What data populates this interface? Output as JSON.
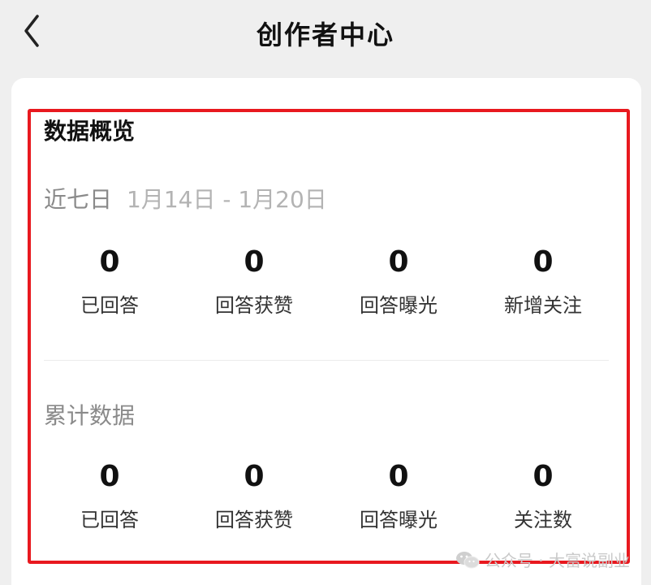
{
  "header": {
    "title": "创作者中心"
  },
  "overview": {
    "title": "数据概览",
    "recent": {
      "label": "近七日",
      "range": "1月14日 - 1月20日",
      "stats": [
        {
          "value": "0",
          "label": "已回答"
        },
        {
          "value": "0",
          "label": "回答获赞"
        },
        {
          "value": "0",
          "label": "回答曝光"
        },
        {
          "value": "0",
          "label": "新增关注"
        }
      ]
    },
    "cumulative": {
      "label": "累计数据",
      "stats": [
        {
          "value": "0",
          "label": "已回答"
        },
        {
          "value": "0",
          "label": "回答获赞"
        },
        {
          "value": "0",
          "label": "回答曝光"
        },
        {
          "value": "0",
          "label": "关注数"
        }
      ]
    }
  },
  "watermark": {
    "icon": "wechat-icon",
    "text": "公众号 · 大富说副业"
  },
  "colors": {
    "background": "#efefef",
    "card": "#ffffff",
    "highlight_border": "#e8191f",
    "muted_text": "#8a8a8a",
    "range_text": "#b3b3b3"
  }
}
